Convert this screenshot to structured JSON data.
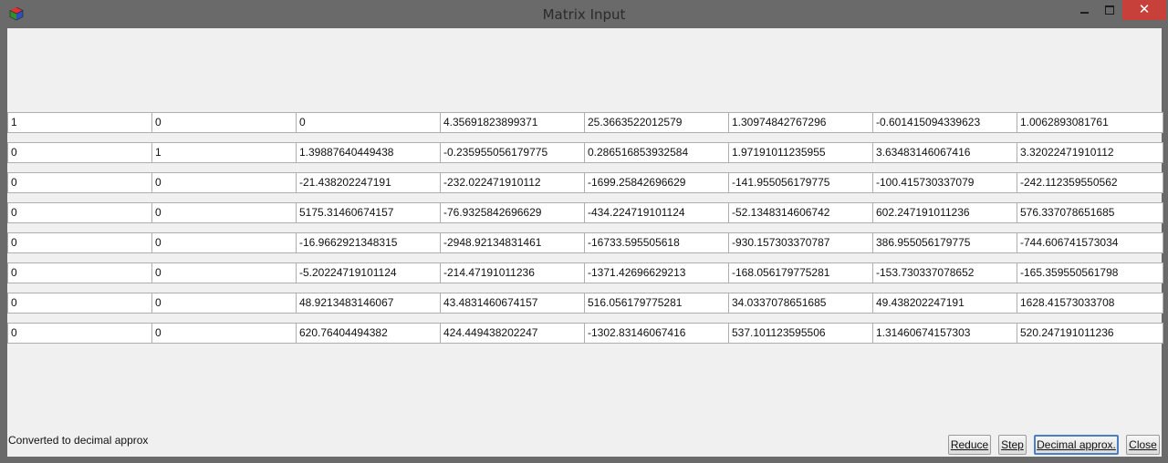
{
  "window": {
    "title": "Matrix Input",
    "close_glyph": "✕",
    "icons": {
      "app": "app-cube-icon",
      "minimize": "minimize-icon",
      "maximize": "maximize-icon",
      "close": "close-icon"
    },
    "close_color": "#c7403a"
  },
  "matrix": {
    "rows": [
      [
        "1",
        "0",
        "0",
        "4.35691823899371",
        "25.3663522012579",
        "1.30974842767296",
        "-0.601415094339623",
        "1.0062893081761"
      ],
      [
        "0",
        "1",
        "1.39887640449438",
        "-0.235955056179775",
        "0.286516853932584",
        "1.97191011235955",
        "3.63483146067416",
        "3.32022471910112"
      ],
      [
        "0",
        "0",
        "-21.438202247191",
        "-232.022471910112",
        "-1699.25842696629",
        "-141.955056179775",
        "-100.415730337079",
        "-242.112359550562"
      ],
      [
        "0",
        "0",
        "5175.31460674157",
        "-76.9325842696629",
        "-434.224719101124",
        "-52.1348314606742",
        "602.247191011236",
        "576.337078651685"
      ],
      [
        "0",
        "0",
        "-16.9662921348315",
        "-2948.92134831461",
        "-16733.595505618",
        "-930.157303370787",
        "386.955056179775",
        "-744.606741573034"
      ],
      [
        "0",
        "0",
        "-5.20224719101124",
        "-214.47191011236",
        "-1371.42696629213",
        "-168.056179775281",
        "-153.730337078652",
        "-165.359550561798"
      ],
      [
        "0",
        "0",
        "48.9213483146067",
        "43.4831460674157",
        "516.056179775281",
        "34.0337078651685",
        "49.438202247191",
        "1628.41573033708"
      ],
      [
        "0",
        "0",
        "620.76404494382",
        "424.449438202247",
        "-1302.83146067416",
        "537.101123595506",
        "1.31460674157303",
        "520.247191011236"
      ]
    ]
  },
  "status": {
    "text": "Converted to decimal approx"
  },
  "buttons": {
    "reduce": "Reduce",
    "step": "Step",
    "decimal": "Decimal approx.",
    "close": "Close"
  }
}
